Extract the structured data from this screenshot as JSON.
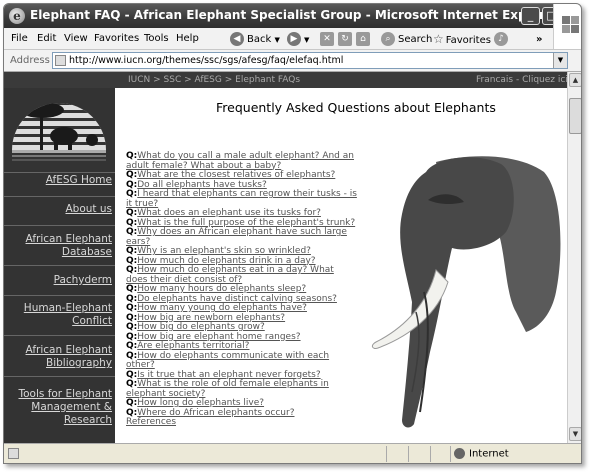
{
  "window": {
    "title": "Elephant FAQ - African Elephant Specialist Group - Microsoft Internet Explorer",
    "minimize": "_",
    "maximize": "□",
    "close": "✕"
  },
  "menu": {
    "file": "File",
    "edit": "Edit",
    "view": "View",
    "favorites": "Favorites",
    "tools": "Tools",
    "help": "Help"
  },
  "toolbar": {
    "back_label": "Back",
    "search_label": "Search",
    "favorites_label": "Favorites",
    "overflow": "»"
  },
  "address": {
    "label": "Address",
    "url": "http://www.iucn.org/themes/ssc/sgs/afesg/faq/elefaq.html"
  },
  "page": {
    "breadcrumb": "IUCN > SSC > AfESG > Elephant FAQs",
    "language": "Francais - Cliquez ici",
    "title": "Frequently Asked Questions about Elephants",
    "q_prefix": "Q:",
    "nav": [
      "AfESG Home",
      "About us",
      "African Elephant Database",
      "Pachyderm",
      "Human-Elephant Conflict",
      "African Elephant Bibliography",
      "Tools for Elephant Management & Research"
    ],
    "questions": [
      "What do you call a male adult elephant? And an adult female? What about a baby?",
      "What are the closest relatives of elephants?",
      "Do all elephants have tusks?",
      "I heard that elephants can regrow their tusks - is it true?",
      "What does an elephant use its tusks for?",
      "What is the full purpose of the elephant's trunk?",
      "Why does an African elephant have such large ears?",
      "Why is an elephant's skin so wrinkled?",
      "How much do elephants drink in a day?",
      "How much do elephants eat in a day? What does their diet consist of?",
      "How many hours do elephants sleep?",
      "Do elephants have distinct calving seasons?",
      "How many young do elephants have?",
      "How big are newborn elephants?",
      "How big do elephants grow?",
      "How big are elephant home ranges?",
      "Are elephants territorial?",
      "How do elephants communicate with each other?",
      "Is it true that an elephant never forgets?",
      "What is the role of old female elephants in elephant society?",
      "How long do elephants live?",
      "Where do African elephants occur?"
    ],
    "references": "References"
  },
  "status": {
    "zone": "Internet"
  },
  "colors": {
    "titlebar": "#3a3a3a",
    "sidebar": "#333333",
    "link": "#555555"
  }
}
